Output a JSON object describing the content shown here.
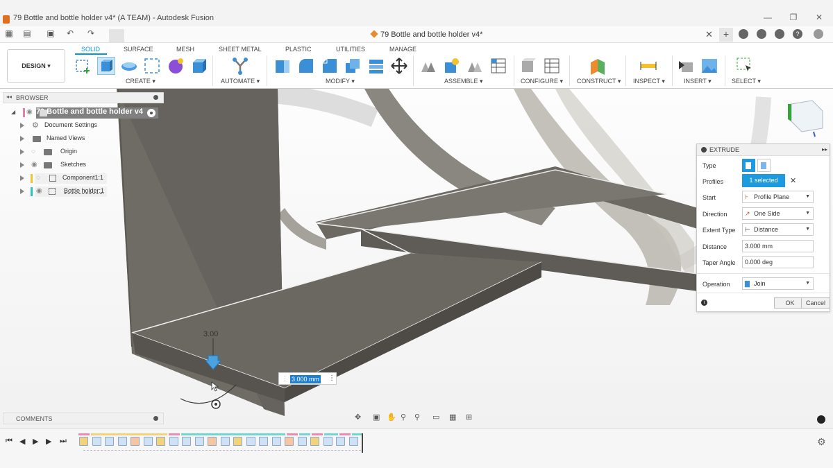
{
  "window": {
    "title": "79 Bottle and bottle holder v4* (A TEAM) - Autodesk Fusion",
    "minimize": "—",
    "maximize": "❐",
    "close": "✕"
  },
  "doc_tab": {
    "title": "79 Bottle and bottle holder v4*",
    "close": "✕",
    "plus": "+"
  },
  "workspace": {
    "label": "DESIGN ▾"
  },
  "tabs": [
    "SOLID",
    "SURFACE",
    "MESH",
    "SHEET METAL",
    "PLASTIC",
    "UTILITIES",
    "MANAGE"
  ],
  "groups": [
    "CREATE ▾",
    "AUTOMATE ▾",
    "MODIFY ▾",
    "ASSEMBLE ▾",
    "CONFIGURE ▾",
    "CONSTRUCT ▾",
    "INSPECT ▾",
    "INSERT ▾",
    "SELECT ▾"
  ],
  "browser": {
    "title": "BROWSER",
    "root": "79 Bottle and bottle holder v4",
    "items": [
      "Document Settings",
      "Named Views",
      "Origin",
      "Sketches",
      "Component1:1",
      "Bottle holder:1"
    ]
  },
  "comments": {
    "title": "COMMENTS"
  },
  "extrude": {
    "title": "EXTRUDE",
    "rows": {
      "type": "Type",
      "profiles": "Profiles",
      "start": "Start",
      "direction": "Direction",
      "extent_type": "Extent Type",
      "distance": "Distance",
      "taper_angle": "Taper Angle",
      "operation": "Operation"
    },
    "values": {
      "profiles": "1 selected",
      "start": "Profile Plane",
      "direction": "One Side",
      "extent_type": "Distance",
      "distance": "3.000 mm",
      "taper_angle": "0.000 deg",
      "operation": "Join"
    },
    "ok": "OK",
    "cancel": "Cancel"
  },
  "dimension": {
    "label": "3.00",
    "input": "3.000 mm"
  },
  "colors": {
    "accent": "#0696d7",
    "selection": "#1e9be0",
    "model": "#6e6b66"
  }
}
